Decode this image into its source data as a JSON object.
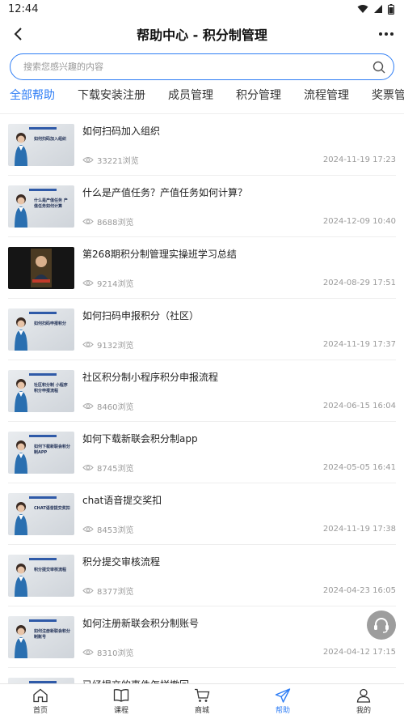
{
  "status": {
    "time": "12:44"
  },
  "header": {
    "title": "帮助中心 - 积分制管理"
  },
  "search": {
    "placeholder": "搜索您感兴趣的内容"
  },
  "tabs": [
    {
      "label": "全部帮助"
    },
    {
      "label": "下载安装注册"
    },
    {
      "label": "成员管理"
    },
    {
      "label": "积分管理"
    },
    {
      "label": "流程管理"
    },
    {
      "label": "奖票管理"
    }
  ],
  "articles": [
    {
      "title": "如何扫码加入组织",
      "views": "33221浏览",
      "date": "2024-11-19 17:23",
      "thumb_text": "如何扫码加入组织"
    },
    {
      "title": "什么是产值任务？产值任务如何计算？",
      "views": "8688浏览",
      "date": "2024-12-09 10:40",
      "thumb_text": "什么是产值任务 产值任务如何计算"
    },
    {
      "title": "第268期积分制管理实操班学习总结",
      "views": "9214浏览",
      "date": "2024-08-29 17:51",
      "thumb_text": ""
    },
    {
      "title": "如何扫码申报积分（社区）",
      "views": "9132浏览",
      "date": "2024-11-19 17:37",
      "thumb_text": "如何扫码申报积分"
    },
    {
      "title": "社区积分制小程序积分申报流程",
      "views": "8460浏览",
      "date": "2024-06-15 16:04",
      "thumb_text": "社区积分制 小程序积分申报流程"
    },
    {
      "title": "如何下载新联会积分制app",
      "views": "8745浏览",
      "date": "2024-05-05 16:41",
      "thumb_text": "如何下载新联会积分制APP"
    },
    {
      "title": "chat语音提交奖扣",
      "views": "8453浏览",
      "date": "2024-11-19 17:38",
      "thumb_text": "CHAT语音提交奖扣"
    },
    {
      "title": "积分提交审核流程",
      "views": "8377浏览",
      "date": "2024-04-23 16:05",
      "thumb_text": "积分提交审核流程"
    },
    {
      "title": "如何注册新联会积分制账号",
      "views": "8310浏览",
      "date": "2024-04-12 17:15",
      "thumb_text": "如何注册新联会积分制账号"
    },
    {
      "title": "已经提交的事件怎样撤回",
      "views": "",
      "date": "",
      "thumb_text": ""
    }
  ],
  "tabbar": [
    {
      "label": "首页",
      "icon": "home-icon"
    },
    {
      "label": "课程",
      "icon": "book-icon"
    },
    {
      "label": "商城",
      "icon": "cart-icon"
    },
    {
      "label": "帮助",
      "icon": "paper-plane-icon"
    },
    {
      "label": "我的",
      "icon": "user-icon"
    }
  ],
  "colors": {
    "accent": "#2f7ef5",
    "text": "#222222",
    "muted": "#999999"
  }
}
